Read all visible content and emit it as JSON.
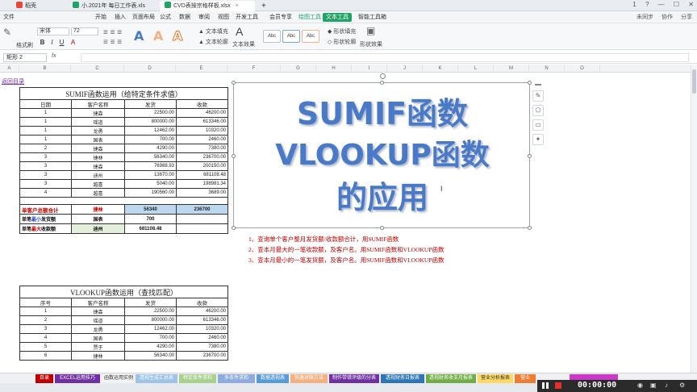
{
  "titlebar": {
    "tabs": [
      {
        "label": "稻壳",
        "color": "#e8483c"
      },
      {
        "label": "小.2021年 每日工作表.xls",
        "color": "#21a366"
      },
      {
        "label": "CVD表操宗格样板.xlsx",
        "color": "#21a366"
      }
    ],
    "new_tab": "+",
    "right": [
      "1",
      "?",
      "—",
      "☐",
      "✕"
    ]
  },
  "menubar": {
    "file": "文件",
    "items": [
      "开始",
      "插入",
      "页面布局",
      "公式",
      "数据",
      "审阅",
      "视图",
      "开发工具",
      "会员专享",
      "绘图工具",
      "文本工具",
      "智能工具箱"
    ],
    "right": [
      "未同步",
      "协作",
      "分享"
    ]
  },
  "ribbon": {
    "format_painter": "格式刷",
    "font_name": "宋体",
    "font_size": "72",
    "bold": "B",
    "italic": "I",
    "underline": "U",
    "text_fill": "文本填充",
    "text_outline": "文本轮廓",
    "text_effect": "文本效果",
    "shape_fill": "形状填充",
    "shape_outline": "形状轮廓",
    "shape_effect": "形状效果",
    "style_sample": "Abc",
    "styleA": "A"
  },
  "formula_bar": {
    "name_box": "矩形 2",
    "fx": "fx"
  },
  "columns": [
    "A",
    "B",
    "C",
    "D",
    "E",
    "F",
    "G",
    "H",
    "I",
    "J",
    "K",
    "L",
    "M",
    "N",
    "O"
  ],
  "back_link": "返回目录",
  "table1": {
    "title": "SUMIF函数运用（给特定条件求值）",
    "headers": [
      "日期",
      "客户名称",
      "发货",
      "收款"
    ],
    "rows": [
      [
        "1",
        "捷森",
        "22500.00",
        "46200.00"
      ],
      [
        "1",
        "瑶道",
        "800000.00",
        "613346.00"
      ],
      [
        "1",
        "龙勇",
        "12462.00",
        "10320.00"
      ],
      [
        "1",
        "国表",
        "700.00",
        "2460.00"
      ],
      [
        "2",
        "捷森",
        "4290.00",
        "7380.00"
      ],
      [
        "3",
        "捷林",
        "56340.00",
        "236700.00"
      ],
      [
        "3",
        "捷森",
        "76988.93",
        "200150.00"
      ],
      [
        "3",
        "迪州",
        "13870.00",
        "681108.48"
      ],
      [
        "3",
        "越喜",
        "5040.00",
        "198981.34"
      ],
      [
        "4",
        "越喜",
        "190560.00",
        "3689.00"
      ]
    ],
    "summary": [
      {
        "label_a": "单客户总额合计",
        "name": "捷林",
        "v1": "56340",
        "v2": "236700"
      },
      {
        "label_pre": "单笔",
        "label_mid": "最小",
        "label_post": "发货额",
        "name": "国表",
        "v1": "700",
        "v2": ""
      },
      {
        "label_pre": "单笔",
        "label_mid": "最大",
        "label_post": "收款额",
        "name": "迪州",
        "v1": "681108.48",
        "v2": ""
      }
    ]
  },
  "table2": {
    "title": "VLOOKUP函数运用（查找匹配）",
    "headers": [
      "序号",
      "客户名称",
      "发货",
      "收款"
    ],
    "rows": [
      [
        "1",
        "捷森",
        "22500.00",
        "46200.00"
      ],
      [
        "2",
        "瑶道",
        "800000.00",
        "613346.00"
      ],
      [
        "3",
        "龙勇",
        "12462.00",
        "10320.00"
      ],
      [
        "4",
        "国表",
        "700.00",
        "2460.00"
      ],
      [
        "5",
        "贾于",
        "4290.00",
        "7380.00"
      ],
      [
        "6",
        "捷林",
        "56340.00",
        "236700.00"
      ]
    ]
  },
  "textbox": {
    "line1": "SUMIF函数",
    "line2": "VLOOKUP函数",
    "line3": "的应用"
  },
  "notes": [
    "1、查询单个客户整月发货额/收款额合计，用SUMIF函数",
    "2、查本月最大的一笔收款额，及客户名。用SUMIF函数和VLOOKUP函数",
    "3、查本月最小的一笔发货额，及客户名。用SUMIF函数和VLOOKUP函数"
  ],
  "sheet_tabs": [
    {
      "label": "目录",
      "color": "#c00000"
    },
    {
      "label": "EXCEL运用技巧",
      "color": "#7030a0"
    },
    {
      "label": "函数运用实例",
      "color": "#f2f2f2",
      "text": "#333"
    },
    {
      "label": "透视生成汇总表",
      "color": "#9dc3e6"
    },
    {
      "label": "特定条件求和",
      "color": "#a9d18e"
    },
    {
      "label": "多条件求和",
      "color": "#8faadc"
    },
    {
      "label": "数据透视表",
      "color": "#5b9bd5"
    },
    {
      "label": "快速对账方法",
      "color": "#f4b183"
    },
    {
      "label": "制作带错评级的分表",
      "color": "#7030a0"
    },
    {
      "label": "透视财务日报表",
      "color": "#2e75b6"
    },
    {
      "label": "透视财务收支月报表",
      "color": "#70ad47"
    },
    {
      "label": "营业分析报表",
      "color": "#ffd966",
      "text": "#333"
    },
    {
      "label": "营业",
      "color": "#ed7d31"
    }
  ],
  "recorder": {
    "time": "00:00:00"
  }
}
